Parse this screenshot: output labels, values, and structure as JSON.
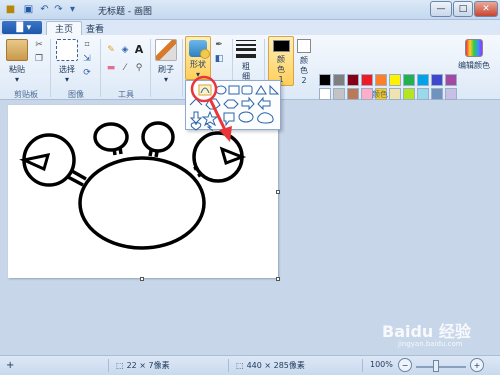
{
  "window": {
    "title": "无标题 - 画图",
    "minimize": "—",
    "maximize": "□",
    "close": "✕"
  },
  "tabs": {
    "file": "▐▌▾",
    "home": "主页",
    "view": "查看"
  },
  "ribbon": {
    "clipboard": {
      "paste": "粘贴",
      "label": "剪贴板"
    },
    "image": {
      "select": "选择",
      "label": "图像"
    },
    "tools": {
      "label": "工具"
    },
    "brushes": {
      "label": "刷子"
    },
    "shapes": {
      "label": "形状"
    },
    "size": {
      "label": "粗细"
    },
    "color1": {
      "label": "颜色 1",
      "value": "#000000"
    },
    "color2": {
      "label": "颜色 2",
      "value": "#ffffff"
    },
    "edit_colors": {
      "label": "编辑颜色"
    },
    "colors_group": {
      "label": "颜色"
    },
    "palette": [
      "#000000",
      "#7f7f7f",
      "#880015",
      "#ed1c24",
      "#ff7f27",
      "#fff200",
      "#22b14c",
      "#00a2e8",
      "#3f48cc",
      "#a349a4",
      "#ffffff",
      "#c3c3c3",
      "#b97a57",
      "#ffaec9",
      "#ffc90e",
      "#efe4b0",
      "#b5e61d",
      "#99d9ea",
      "#7092be",
      "#c8bfe7",
      "#ffffff",
      "#ffffff",
      "#ffffff",
      "#ffffff",
      "#ffffff",
      "#ffffff",
      "#ffffff",
      "#ffffff",
      "#ffffff",
      "#ffffff"
    ]
  },
  "status": {
    "cursor": "22 × 7像素",
    "size": "440 × 285像素",
    "zoom": "100%"
  },
  "watermark": {
    "brand": "Baidu 经验",
    "sub": "jingyan.baidu.com"
  },
  "colors": {
    "accent": "#ffcf5a",
    "highlight_circle": "#e8363a",
    "arrow": "#e8363a"
  }
}
